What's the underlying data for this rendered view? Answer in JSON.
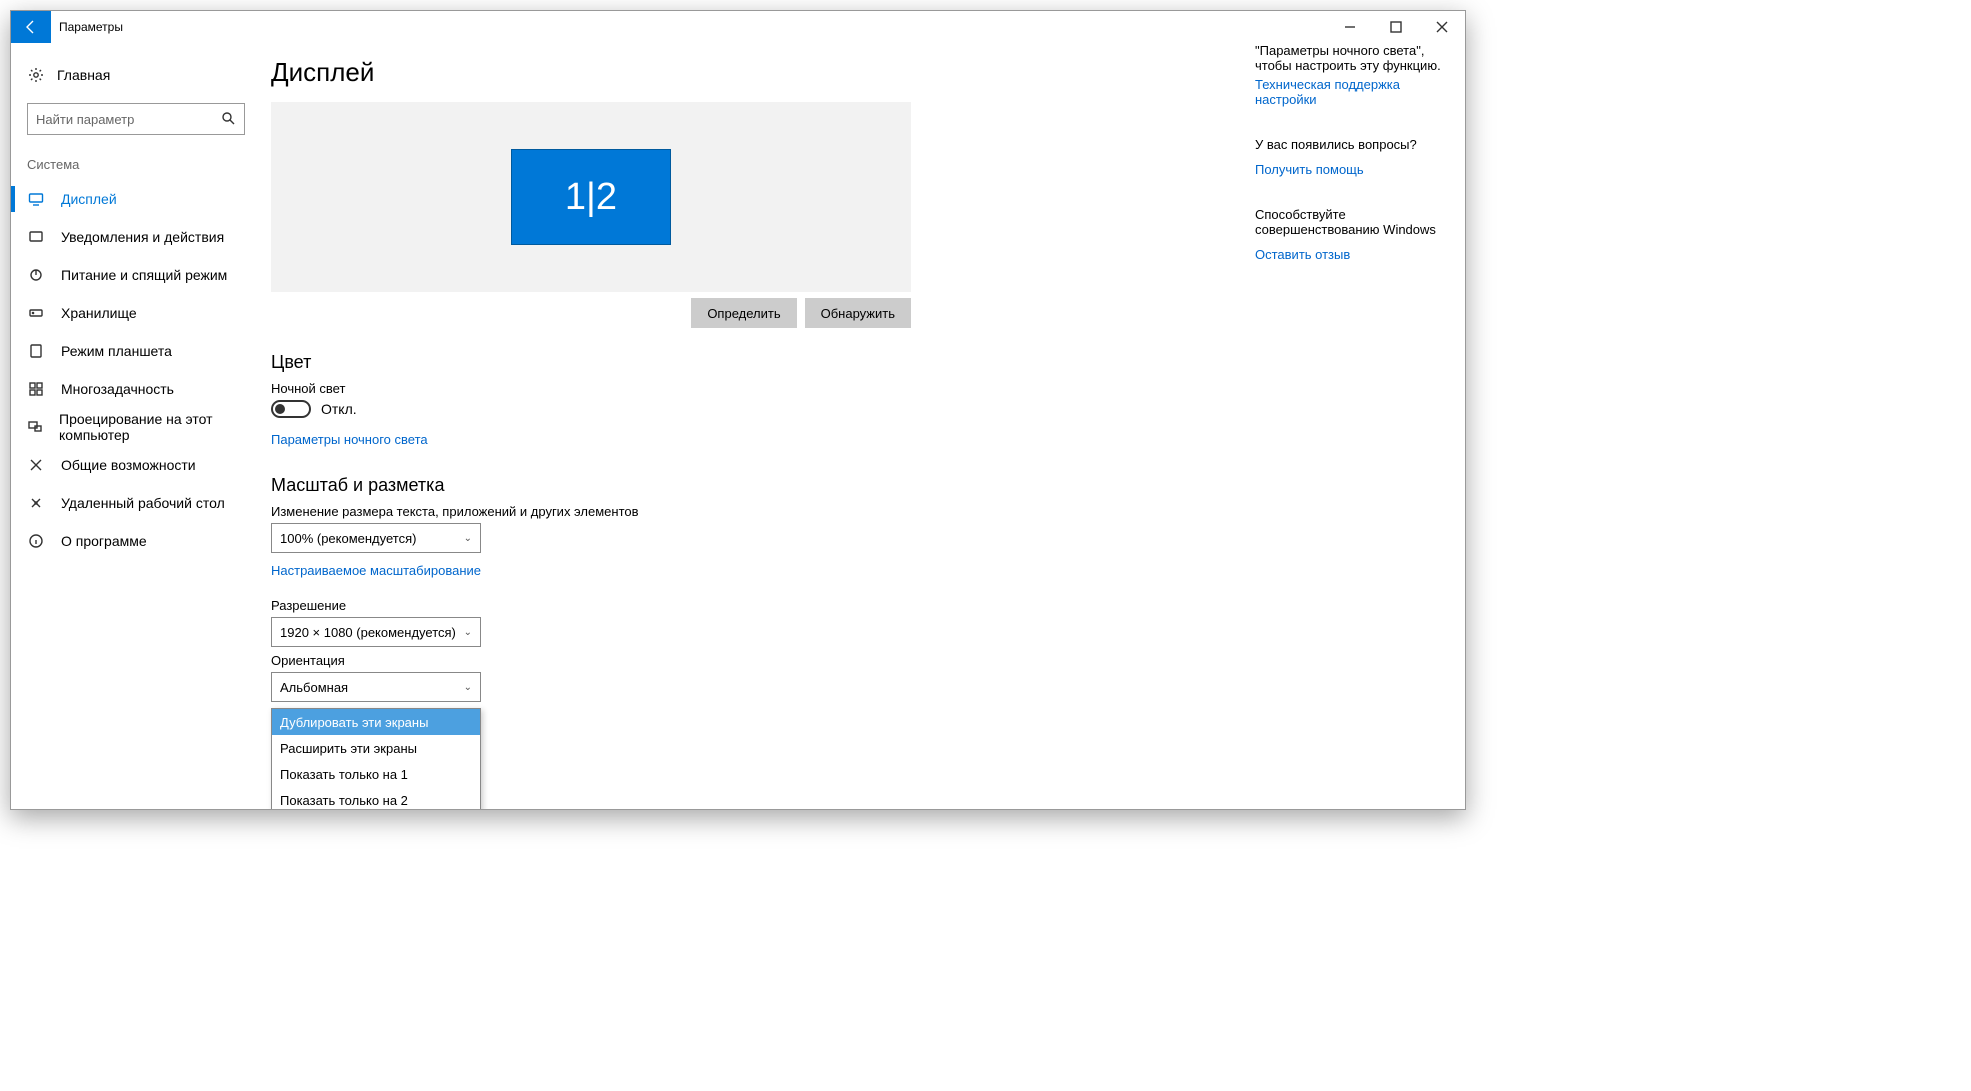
{
  "window": {
    "title": "Параметры"
  },
  "sidebar": {
    "home": "Главная",
    "search_placeholder": "Найти параметр",
    "section": "Система",
    "items": [
      {
        "label": "Дисплей"
      },
      {
        "label": "Уведомления и действия"
      },
      {
        "label": "Питание и спящий режим"
      },
      {
        "label": "Хранилище"
      },
      {
        "label": "Режим планшета"
      },
      {
        "label": "Многозадачность"
      },
      {
        "label": "Проецирование на этот компьютер"
      },
      {
        "label": "Общие возможности"
      },
      {
        "label": "Удаленный рабочий стол"
      },
      {
        "label": "О программе"
      }
    ]
  },
  "main": {
    "title": "Дисплей",
    "monitor_label": "1|2",
    "identify_btn": "Определить",
    "detect_btn": "Обнаружить",
    "color_heading": "Цвет",
    "night_light_label": "Ночной свет",
    "night_light_state": "Откл.",
    "night_light_link": "Параметры ночного света",
    "scale_heading": "Масштаб и разметка",
    "scale_label": "Изменение размера текста, приложений и других элементов",
    "scale_value": "100% (рекомендуется)",
    "scale_link": "Настраиваемое масштабирование",
    "resolution_label": "Разрешение",
    "resolution_value": "1920 × 1080 (рекомендуется)",
    "orientation_label": "Ориентация",
    "orientation_value": "Альбомная",
    "multi_options": [
      "Дублировать эти экраны",
      "Расширить эти экраны",
      "Показать только на 1",
      "Показать только на 2"
    ]
  },
  "right": {
    "tip_text": "\"Параметры ночного света\", чтобы настроить эту функцию.",
    "tip_link": "Техническая поддержка настройки",
    "q_head": "У вас появились вопросы?",
    "q_link": "Получить помощь",
    "fb_head": "Способствуйте совершенствованию Windows",
    "fb_link": "Оставить отзыв"
  }
}
